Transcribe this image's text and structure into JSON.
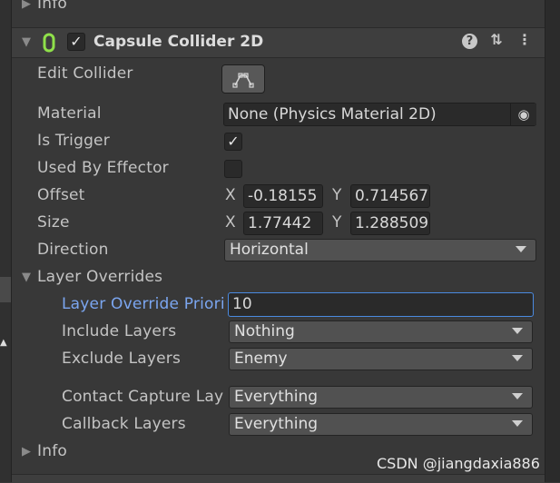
{
  "info_top_label": "Info",
  "component": {
    "title": "Capsule Collider 2D",
    "enabled_check": "✓"
  },
  "properties": {
    "edit_collider": "Edit Collider",
    "material_label": "Material",
    "material_value": "None (Physics Material 2D)",
    "is_trigger_label": "Is Trigger",
    "is_trigger_check": "✓",
    "used_by_effector_label": "Used By Effector",
    "offset_label": "Offset",
    "offset_x_label": "X",
    "offset_x": "-0.18155",
    "offset_y_label": "Y",
    "offset_y": "0.714567",
    "size_label": "Size",
    "size_x_label": "X",
    "size_x": "1.77442",
    "size_y_label": "Y",
    "size_y": "1.288509",
    "direction_label": "Direction",
    "direction_value": "Horizontal"
  },
  "layer_overrides": {
    "label": "Layer Overrides",
    "priority_label": "Layer Override Priori",
    "priority_value": "10",
    "include_label": "Include Layers",
    "include_value": "Nothing",
    "exclude_label": "Exclude Layers",
    "exclude_value": "Enemy",
    "contact_label": "Contact Capture Lay",
    "contact_value": "Everything",
    "callback_label": "Callback Layers",
    "callback_value": "Everything"
  },
  "info_bottom_label": "Info",
  "watermark": "CSDN @jiangdaxia886",
  "icons": {
    "help": "?",
    "presets": "⇅",
    "more": "⋮",
    "target": "◉"
  },
  "colors": {
    "background": "#383838",
    "active_label": "#7ba6f0",
    "focus_border": "#4a8ae0"
  }
}
